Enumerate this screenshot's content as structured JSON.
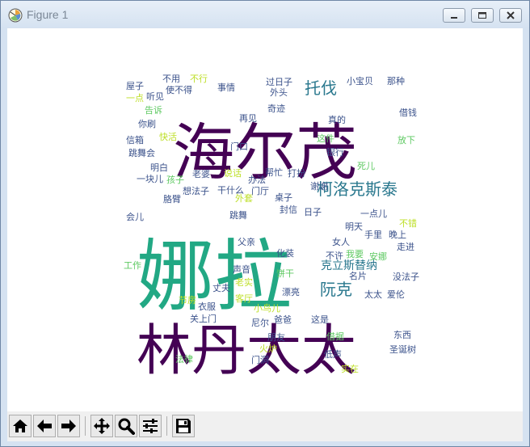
{
  "window": {
    "title": "Figure 1",
    "icon": "matplotlib-icon",
    "controls": [
      "minimize-icon",
      "maximize-icon",
      "close-icon"
    ]
  },
  "toolbar": {
    "buttons": [
      {
        "name": "home-button",
        "icon": "home-icon"
      },
      {
        "name": "back-button",
        "icon": "arrow-left-icon"
      },
      {
        "name": "forward-button",
        "icon": "arrow-right-icon"
      },
      {
        "name": "pan-button",
        "icon": "move-arrows-icon"
      },
      {
        "name": "zoom-button",
        "icon": "magnifier-icon"
      },
      {
        "name": "subplots-button",
        "icon": "sliders-icon"
      },
      {
        "name": "save-button",
        "icon": "floppy-disk-icon"
      }
    ]
  },
  "colors": {
    "dark_purple": "#440154",
    "teal_green": "#22a884",
    "blue": "#3b528b",
    "teal": "#2a788e",
    "green": "#5ec962",
    "yellow_green": "#bddf26"
  },
  "chart_data": {
    "type": "wordcloud",
    "words": [
      {
        "text": "娜拉",
        "color": "#22a884"
      },
      {
        "text": "海尔茂",
        "color": "#440154"
      },
      {
        "text": "林丹太太",
        "color": "#440154"
      },
      {
        "text": "柯洛克斯泰",
        "color": "#2a788e"
      },
      {
        "text": "托伐",
        "color": "#2a788e"
      },
      {
        "text": "阮克",
        "color": "#2a788e"
      },
      {
        "text": "克立斯替纳",
        "color": "#2a788e"
      },
      {
        "text": "屋子",
        "color": "#3b528b"
      },
      {
        "text": "不用",
        "color": "#3b528b"
      },
      {
        "text": "不行",
        "color": "#bddf26"
      },
      {
        "text": "使不得",
        "color": "#3b528b"
      },
      {
        "text": "一点",
        "color": "#bddf26"
      },
      {
        "text": "听见",
        "color": "#3b528b"
      },
      {
        "text": "事情",
        "color": "#3b528b"
      },
      {
        "text": "过日子",
        "color": "#3b528b"
      },
      {
        "text": "小宝贝",
        "color": "#3b528b"
      },
      {
        "text": "那种",
        "color": "#3b528b"
      },
      {
        "text": "告诉",
        "color": "#5ec962"
      },
      {
        "text": "外头",
        "color": "#3b528b"
      },
      {
        "text": "奇迹",
        "color": "#3b528b"
      },
      {
        "text": "借钱",
        "color": "#3b528b"
      },
      {
        "text": "你刷",
        "color": "#3b528b"
      },
      {
        "text": "再见",
        "color": "#3b528b"
      },
      {
        "text": "真的",
        "color": "#3b528b"
      },
      {
        "text": "信箱",
        "color": "#3b528b"
      },
      {
        "text": "快活",
        "color": "#bddf26"
      },
      {
        "text": "门口",
        "color": "#3b528b"
      },
      {
        "text": "这件",
        "color": "#5ec962"
      },
      {
        "text": "放下",
        "color": "#5ec962"
      },
      {
        "text": "跳舞会",
        "color": "#3b528b"
      },
      {
        "text": "银行",
        "color": "#3b528b"
      },
      {
        "text": "死儿",
        "color": "#5ec962"
      },
      {
        "text": "明白",
        "color": "#3b528b"
      },
      {
        "text": "老婆",
        "color": "#3b528b"
      },
      {
        "text": "说话",
        "color": "#bddf26"
      },
      {
        "text": "办法",
        "color": "#3b528b"
      },
      {
        "text": "帮忙",
        "color": "#3b528b"
      },
      {
        "text": "打扮",
        "color": "#3b528b"
      },
      {
        "text": "谢谢",
        "color": "#3b528b"
      },
      {
        "text": "一块儿",
        "color": "#3b528b"
      },
      {
        "text": "孩子",
        "color": "#5ec962"
      },
      {
        "text": "想法子",
        "color": "#3b528b"
      },
      {
        "text": "干什么",
        "color": "#3b528b"
      },
      {
        "text": "门厅",
        "color": "#3b528b"
      },
      {
        "text": "桌子",
        "color": "#3b528b"
      },
      {
        "text": "一点儿",
        "color": "#3b528b"
      },
      {
        "text": "胳臂",
        "color": "#3b528b"
      },
      {
        "text": "外套",
        "color": "#bddf26"
      },
      {
        "text": "封信",
        "color": "#3b528b"
      },
      {
        "text": "明天",
        "color": "#3b528b"
      },
      {
        "text": "会儿",
        "color": "#3b528b"
      },
      {
        "text": "跳舞",
        "color": "#3b528b"
      },
      {
        "text": "日子",
        "color": "#3b528b"
      },
      {
        "text": "不错",
        "color": "#bddf26"
      },
      {
        "text": "手里",
        "color": "#3b528b"
      },
      {
        "text": "晚上",
        "color": "#3b528b"
      },
      {
        "text": "父亲",
        "color": "#3b528b"
      },
      {
        "text": "女人",
        "color": "#3b528b"
      },
      {
        "text": "走进",
        "color": "#3b528b"
      },
      {
        "text": "我要",
        "color": "#5ec962"
      },
      {
        "text": "化装",
        "color": "#3b528b"
      },
      {
        "text": "不许",
        "color": "#3b528b"
      },
      {
        "text": "安娜",
        "color": "#5ec962"
      },
      {
        "text": "没法子",
        "color": "#3b528b"
      },
      {
        "text": "工作",
        "color": "#5ec962"
      },
      {
        "text": "声音",
        "color": "#3b528b"
      },
      {
        "text": "饼干",
        "color": "#5ec962"
      },
      {
        "text": "名片",
        "color": "#3b528b"
      },
      {
        "text": "老实",
        "color": "#bddf26"
      },
      {
        "text": "漂亮",
        "color": "#3b528b"
      },
      {
        "text": "丈夫",
        "color": "#3b528b"
      },
      {
        "text": "太太",
        "color": "#3b528b"
      },
      {
        "text": "爱伦",
        "color": "#3b528b"
      },
      {
        "text": "节房",
        "color": "#bddf26"
      },
      {
        "text": "客厅",
        "color": "#bddf26"
      },
      {
        "text": "衣服",
        "color": "#3b528b"
      },
      {
        "text": "小鸟儿",
        "color": "#bddf26"
      },
      {
        "text": "关上门",
        "color": "#3b528b"
      },
      {
        "text": "爸爸",
        "color": "#3b528b"
      },
      {
        "text": "这是",
        "color": "#3b528b"
      },
      {
        "text": "尼尔",
        "color": "#3b528b"
      },
      {
        "text": "朋友",
        "color": "#3b528b"
      },
      {
        "text": "借据",
        "color": "#5ec962"
      },
      {
        "text": "东西",
        "color": "#3b528b"
      },
      {
        "text": "火炉",
        "color": "#bddf26"
      },
      {
        "text": "法律",
        "color": "#5ec962"
      },
      {
        "text": "门洞",
        "color": "#3b528b"
      },
      {
        "text": "低声",
        "color": "#3b528b"
      },
      {
        "text": "实在",
        "color": "#bddf26"
      },
      {
        "text": "圣诞树",
        "color": "#3b528b"
      }
    ]
  }
}
